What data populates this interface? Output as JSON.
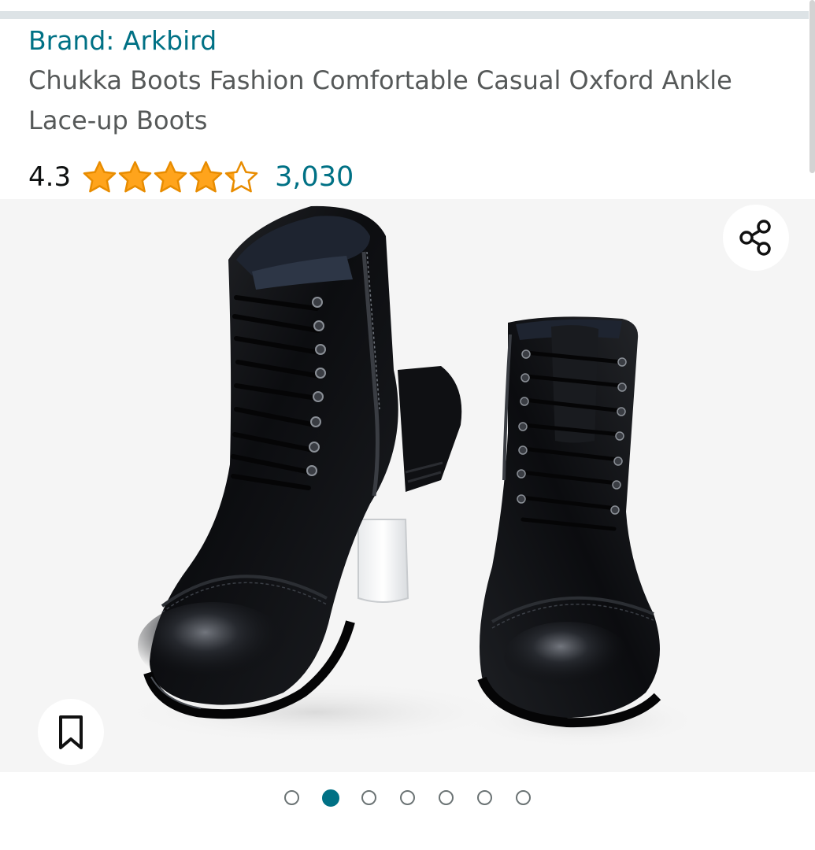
{
  "product": {
    "brand_label": "Brand: Arkbird",
    "title": "Chukka Boots Fashion Comfortable Casual Oxford Ankle Lace-up Boots"
  },
  "rating": {
    "value_text": "4.3",
    "stars_value": 4.3,
    "stars_max": 5,
    "review_count": "3,030"
  },
  "gallery": {
    "image_subject": "pair of black leather cap-toe lace-up ankle boots with side zipper",
    "total_images": 7,
    "active_index": 1
  },
  "icons": {
    "share": "share-icon",
    "save": "bookmark-icon",
    "star": "star-icon"
  },
  "colors": {
    "link": "#007185",
    "star": "#ffa41c",
    "title_text": "#565959",
    "gallery_background": "#f5f5f5"
  }
}
